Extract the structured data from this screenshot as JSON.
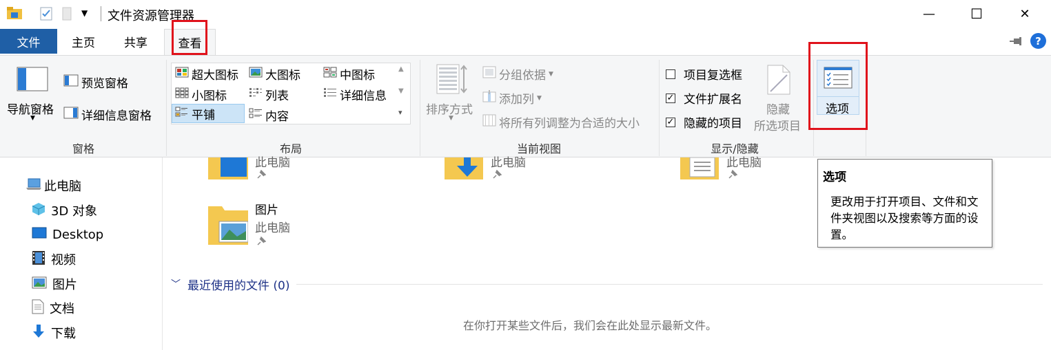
{
  "window": {
    "title": "文件资源管理器",
    "controls": {
      "minimize": "—",
      "maximize": "☐",
      "close": "✕"
    }
  },
  "tabs": [
    {
      "label": "文件"
    },
    {
      "label": "主页"
    },
    {
      "label": "共享"
    },
    {
      "label": "查看"
    }
  ],
  "ribbon": {
    "panes": {
      "nav_pane": "导航窗格",
      "preview_pane": "预览窗格",
      "details_pane": "详细信息窗格",
      "label": "窗格"
    },
    "layout": {
      "items": [
        "超大图标",
        "大图标",
        "中图标",
        "小图标",
        "列表",
        "详细信息",
        "平铺",
        "内容"
      ],
      "selected": "平铺",
      "label": "布局"
    },
    "current_view": {
      "sort_by": "排序方式",
      "group_by": "分组依据",
      "add_column": "添加列",
      "size_all": "将所有列调整为合适的大小",
      "label": "当前视图"
    },
    "show_hide": {
      "item_checkboxes": {
        "label": "项目复选框",
        "checked": false
      },
      "file_extensions": {
        "label": "文件扩展名",
        "checked": true
      },
      "hidden_items": {
        "label": "隐藏的项目",
        "checked": true
      },
      "hide_selected_line1": "隐藏",
      "hide_selected_line2": "所选项目",
      "label": "显示/隐藏"
    },
    "options": {
      "label": "选项"
    }
  },
  "nav": [
    {
      "label": "此电脑",
      "icon": "computer-icon"
    },
    {
      "label": "3D 对象",
      "icon": "cube-icon"
    },
    {
      "label": "Desktop",
      "icon": "desktop-icon"
    },
    {
      "label": "视频",
      "icon": "film-icon"
    },
    {
      "label": "图片",
      "icon": "picture-icon"
    },
    {
      "label": "文档",
      "icon": "document-icon"
    },
    {
      "label": "下载",
      "icon": "download-icon"
    }
  ],
  "content": {
    "quick_access": [
      {
        "sub": "此电脑"
      },
      {
        "sub": "此电脑"
      },
      {
        "sub": "此电脑"
      },
      {
        "name": "图片",
        "sub": "此电脑"
      }
    ],
    "recent_header": "最近使用的文件 (0)",
    "recent_empty": "在你打开某些文件后，我们会在此处显示最新文件。"
  },
  "tooltip": {
    "title": "选项",
    "body": "更改用于打开项目、文件和文件夹视图以及搜索等方面的设置。"
  },
  "colors": {
    "file_tab": "#1f5fa6",
    "highlight": "#e0121b",
    "selected_bg": "#cce4f7",
    "link_blue": "#1e3287"
  }
}
